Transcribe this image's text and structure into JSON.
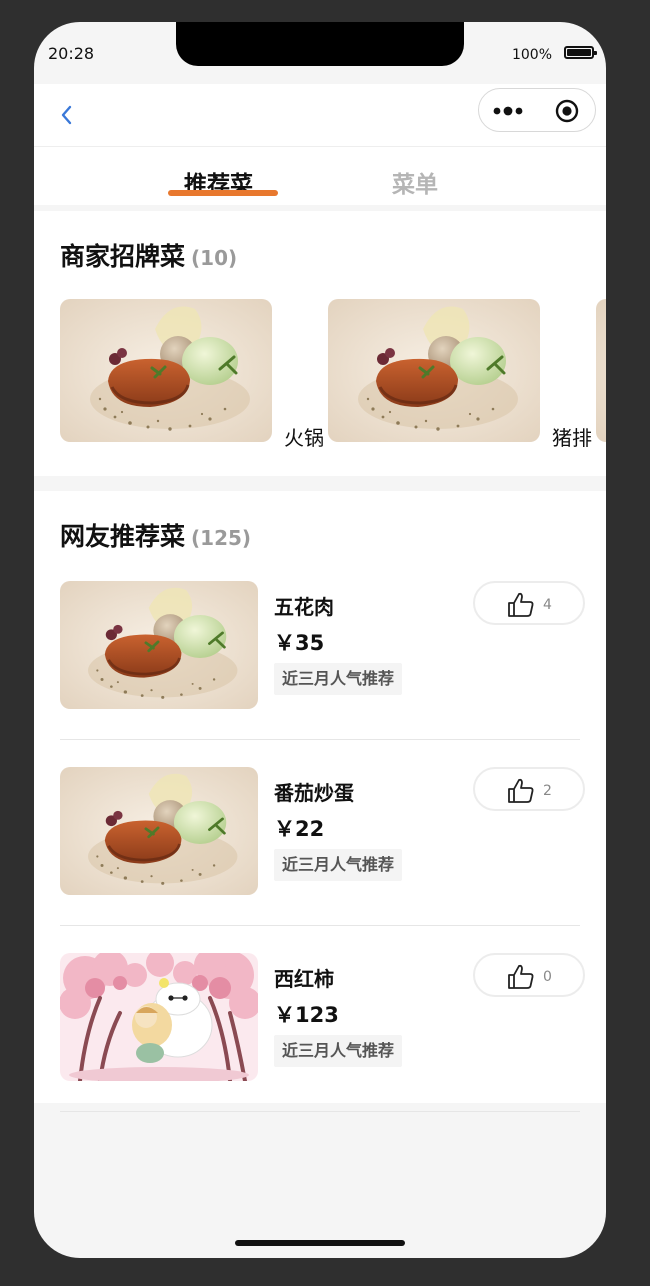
{
  "status_bar": {
    "time": "20:28",
    "battery_pct": "100%",
    "battery_level": 1.0
  },
  "navbar": {
    "back_icon": "chevron-left-icon",
    "menu_icon": "more-dots-icon",
    "close_icon": "target-circle-icon"
  },
  "tabs": [
    {
      "label": "推荐菜",
      "active": true
    },
    {
      "label": "菜单",
      "active": false
    }
  ],
  "signature": {
    "title": "商家招牌菜",
    "count": "(10)",
    "items": [
      {
        "name": "火锅",
        "image": "food-plate"
      },
      {
        "name": "猪排",
        "image": "food-plate"
      },
      {
        "name": "",
        "image": "food-plate"
      }
    ]
  },
  "recommended": {
    "title": "网友推荐菜",
    "count": "(125)",
    "items": [
      {
        "name": "五花肉",
        "price": "￥35",
        "tag": "近三月人气推荐",
        "likes": "4",
        "image": "food-plate"
      },
      {
        "name": "番茄炒蛋",
        "price": "￥22",
        "tag": "近三月人气推荐",
        "likes": "2",
        "image": "food-plate"
      },
      {
        "name": "西红柿",
        "price": "￥123",
        "tag": "近三月人气推荐",
        "likes": "0",
        "image": "cartoon-blossom"
      }
    ]
  },
  "colors": {
    "accent": "#e8782e",
    "back_arrow": "#3a78d8"
  }
}
